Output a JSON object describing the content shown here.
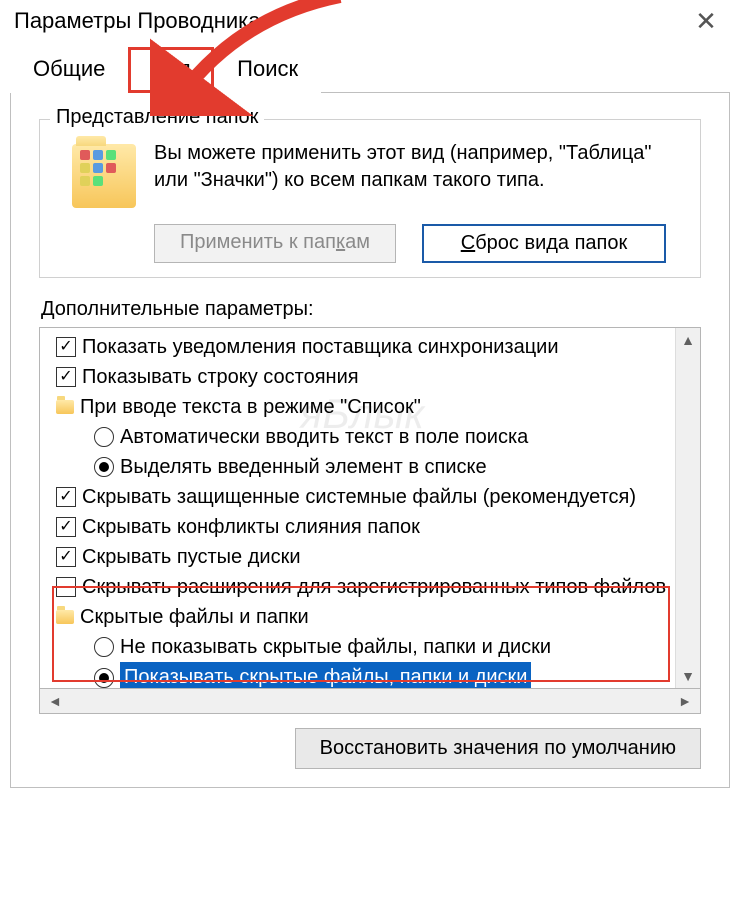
{
  "window": {
    "title": "Параметры Проводника"
  },
  "tabs": {
    "general": "Общие",
    "view": "Вид",
    "search": "Поиск"
  },
  "folder_views": {
    "legend": "Представление папок",
    "description": "Вы можете применить этот вид (например, \"Таблица\" или \"Значки\") ко всем папкам такого типа.",
    "apply_label_pre": "Применить к пап",
    "apply_label_u": "к",
    "apply_label_post": "ам",
    "reset_label_u": "С",
    "reset_label_post": "брос вида папок"
  },
  "advanced": {
    "label": "Дополнительные параметры:",
    "items": {
      "sync_notify": "Показать уведомления поставщика синхронизации",
      "status_bar": "Показывать строку состояния",
      "list_input": "При вводе текста в режиме \"Список\"",
      "auto_search": "Автоматически вводить текст в поле поиска",
      "select_item": "Выделять введенный элемент в списке",
      "hide_protected": "Скрывать защищенные системные файлы (рекомендуется)",
      "hide_merge": "Скрывать конфликты слияния папок",
      "hide_empty": "Скрывать пустые диски",
      "hide_ext": "Скрывать расширения для зарегистрированных типов файлов",
      "hidden_group": "Скрытые файлы и папки",
      "hidden_no": "Не показывать скрытые файлы, папки и диски",
      "hidden_yes": "Показывать скрытые файлы, папки и диски"
    }
  },
  "restore": {
    "label": "Восстановить значения по умолчанию"
  },
  "watermark": "яБлык"
}
